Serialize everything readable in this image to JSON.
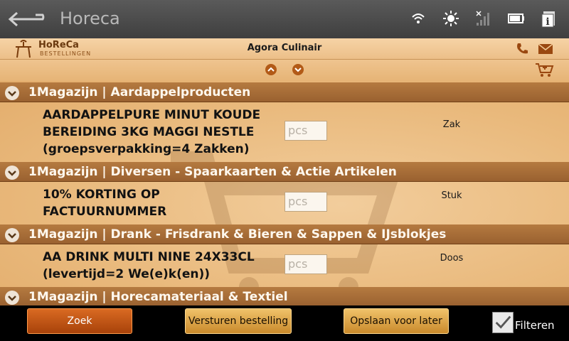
{
  "actionbar": {
    "title": "Horeca"
  },
  "header": {
    "logo_text": "HoReCa",
    "logo_sub": "BESTELLINGEN",
    "company": "Agora Culinair"
  },
  "groups": [
    {
      "title": "1Magazijn  |  Aardappelproducten",
      "item": {
        "name": "AARDAPPELPURE MINUT KOUDE BEREIDING 3KG MAGGI NESTLE (groepsverpakking=4 Zakken)",
        "qty_placeholder": "pcs",
        "unit": "Zak"
      }
    },
    {
      "title": "1Magazijn  |  Diversen - Spaarkaarten & Actie Artikelen",
      "item": {
        "name": "10% KORTING OP FACTUURNUMMER",
        "qty_placeholder": "pcs",
        "unit": "Stuk"
      }
    },
    {
      "title": "1Magazijn  |  Drank - Frisdrank & Bieren & Sappen & IJsblokjes",
      "item": {
        "name": "AA DRINK MULTI NINE 24X33CL (levertijd=2 We(e)k(en))",
        "qty_placeholder": "pcs",
        "unit": "Doos"
      }
    },
    {
      "title": "1Magazijn  |  Horecamateriaal & Textiel"
    }
  ],
  "toolbar": {
    "search_label": "Zoek",
    "send_label": "Versturen bestelling",
    "save_label": "Opslaan voor later",
    "filter_label": "Filteren",
    "filter_checked": true
  },
  "colors": {
    "accent": "#b25a17",
    "group_header": "#a86b36",
    "button_gold": "#e0a84e"
  }
}
